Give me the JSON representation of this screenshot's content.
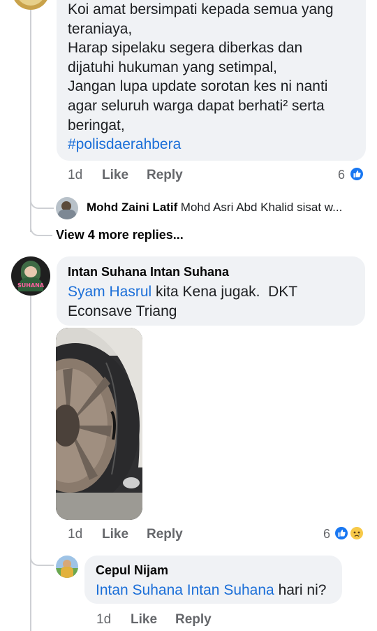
{
  "comment1": {
    "lines": [
      "Koi amat bersimpati kepada semua yang",
      "teraniaya,",
      "Harap sipelaku segera diberkas dan",
      "dijatuhi hukuman yang setimpal,",
      "Jangan lupa update sorotan kes ni nanti",
      "agar seluruh warga dapat berhati² serta",
      "beringat,"
    ],
    "hashtag": "#polisdaerahbera",
    "time": "1d",
    "like_label": "Like",
    "reply_label": "Reply",
    "reaction_count": "6",
    "reply_preview": {
      "author": "Mohd Zaini Latif",
      "snippet": "Mohd Asri Abd Khalid sisat w..."
    },
    "view_more": "View 4 more replies..."
  },
  "comment2": {
    "author": "Intan Suhana Intan Suhana",
    "mention": "Syam Hasrul",
    "text_line1": " kita Kena jugak.  DKT",
    "text_line2": "Econsave Triang",
    "avatar_label": "SUHANA",
    "time": "1d",
    "like_label": "Like",
    "reply_label": "Reply",
    "reaction_count": "6"
  },
  "reply": {
    "author": "Cepul Nijam",
    "mention": "Intan Suhana Intan Suhana",
    "text": " hari ni?",
    "time": "1d",
    "like_label": "Like",
    "reply_label": "Reply"
  },
  "colors": {
    "bubble": "#f0f2f5",
    "link": "#1a6ed8",
    "meta": "#65676b",
    "like_blue": "#1877f2"
  }
}
